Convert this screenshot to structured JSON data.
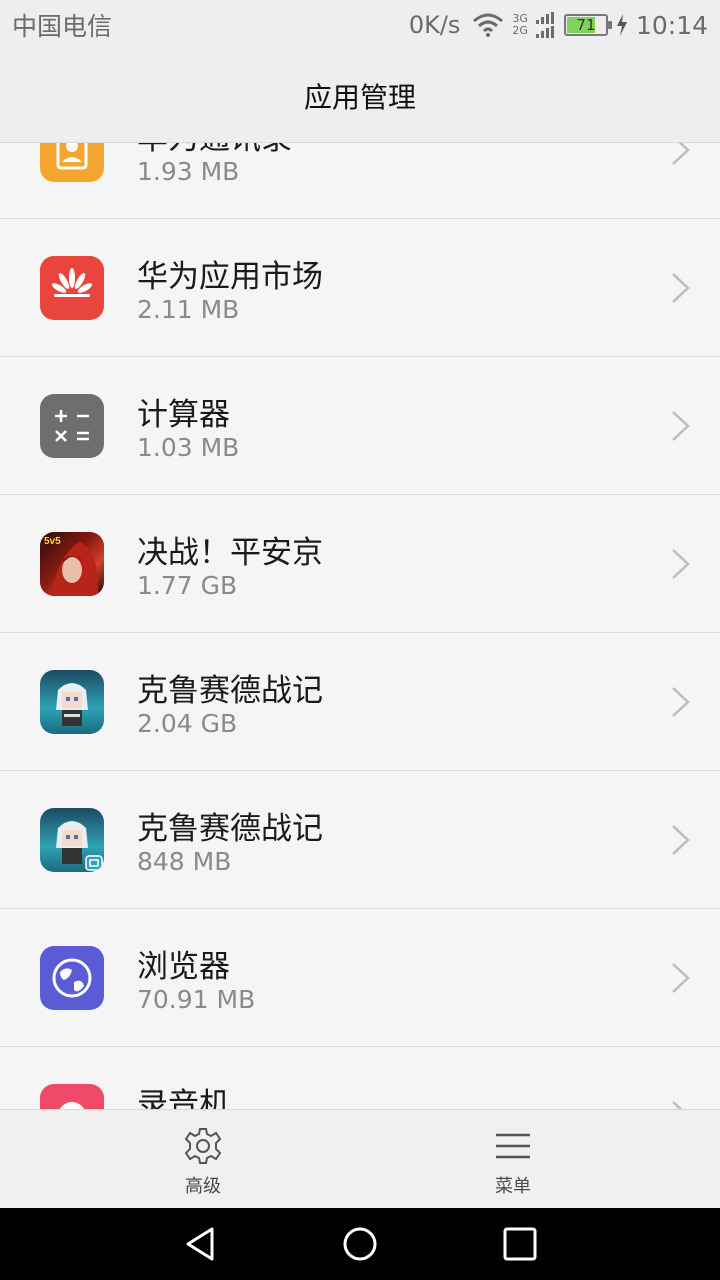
{
  "status_bar": {
    "carrier": "中国电信",
    "net_speed": "0K/s",
    "net_3g": "3G",
    "net_2g": "2G",
    "battery": "71",
    "time": "10:14",
    "icons": [
      "wifi-icon",
      "signal-icon",
      "battery-icon",
      "charging-icon"
    ]
  },
  "header": {
    "title": "应用管理"
  },
  "apps": [
    {
      "name": "华为通讯录",
      "size": "1.93 MB",
      "icon": "contacts-icon"
    },
    {
      "name": "华为应用市场",
      "size": "2.11 MB",
      "icon": "huawei-appgallery-icon"
    },
    {
      "name": "计算器",
      "size": "1.03 MB",
      "icon": "calculator-icon"
    },
    {
      "name": "决战！平安京",
      "size": "1.77 GB",
      "icon": "game-onmyoji-icon"
    },
    {
      "name": "克鲁赛德战记",
      "size": "2.04 GB",
      "icon": "game-crusaders-icon"
    },
    {
      "name": "克鲁赛德战记",
      "size": "848 MB",
      "icon": "game-crusaders-clone-icon"
    },
    {
      "name": "浏览器",
      "size": "70.91 MB",
      "icon": "browser-icon"
    },
    {
      "name": "录音机",
      "size": "",
      "icon": "recorder-icon"
    }
  ],
  "bottom_tabs": [
    {
      "label": "高级",
      "icon": "gear-icon"
    },
    {
      "label": "菜单",
      "icon": "menu-icon"
    }
  ],
  "colors": {
    "contacts": "#f4a530",
    "appgallery": "#e8453c",
    "calculator": "#6e6e6e",
    "browser": "#5b5bd6",
    "recorder": "#f04a6a"
  }
}
